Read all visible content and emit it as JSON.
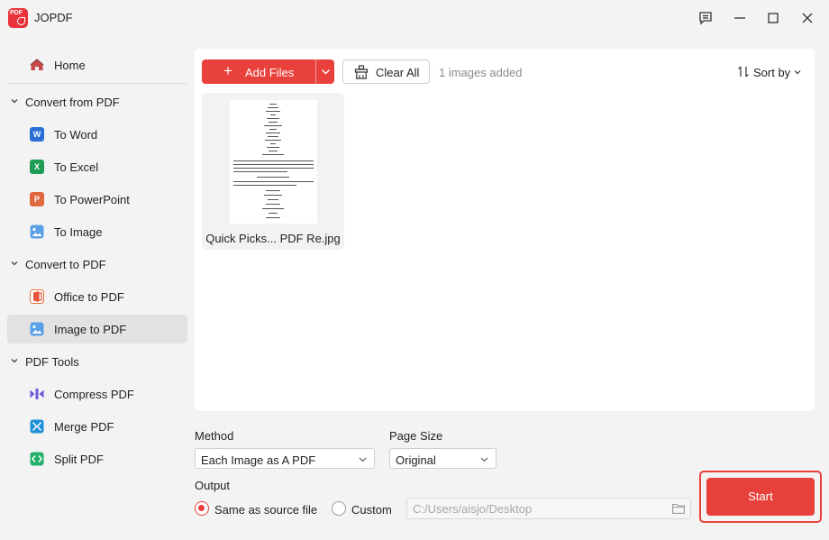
{
  "app": {
    "title": "JOPDF",
    "logo_text": "PDF"
  },
  "window_controls": [
    "feedback-icon",
    "minimize-icon",
    "maximize-icon",
    "close-icon"
  ],
  "sidebar": {
    "home": "Home",
    "sections": [
      {
        "label": "Convert from PDF",
        "items": [
          "To Word",
          "To Excel",
          "To PowerPoint",
          "To Image"
        ]
      },
      {
        "label": "Convert to PDF",
        "items": [
          "Office to PDF",
          "Image to PDF"
        ]
      },
      {
        "label": "PDF Tools",
        "items": [
          "Compress PDF",
          "Merge PDF",
          "Split PDF"
        ]
      }
    ],
    "active_item": "Image to PDF",
    "icon_letters": {
      "word": "W",
      "excel": "X",
      "powerpoint": "P"
    }
  },
  "toolbar": {
    "add_files": "Add Files",
    "clear_all": "Clear All",
    "count_text": "1 images added",
    "sort_by": "Sort by"
  },
  "files": [
    {
      "name": "Quick Picks... PDF Re.jpg"
    }
  ],
  "options": {
    "method_label": "Method",
    "method_value": "Each Image as A PDF",
    "page_size_label": "Page Size",
    "page_size_value": "Original",
    "output_label": "Output",
    "output_same": "Same as source file",
    "output_custom": "Custom",
    "output_path": "C:/Users/aisjo/Desktop",
    "output_selected": "same"
  },
  "start_label": "Start",
  "colors": {
    "accent": "#e8403a",
    "word": "#2b6fd6",
    "excel": "#1f9d55",
    "powerpoint": "#e0683f",
    "image": "#5aa0e6",
    "compress": "#6b5bd6",
    "merge": "#1e8fd8",
    "split": "#25b06a"
  }
}
